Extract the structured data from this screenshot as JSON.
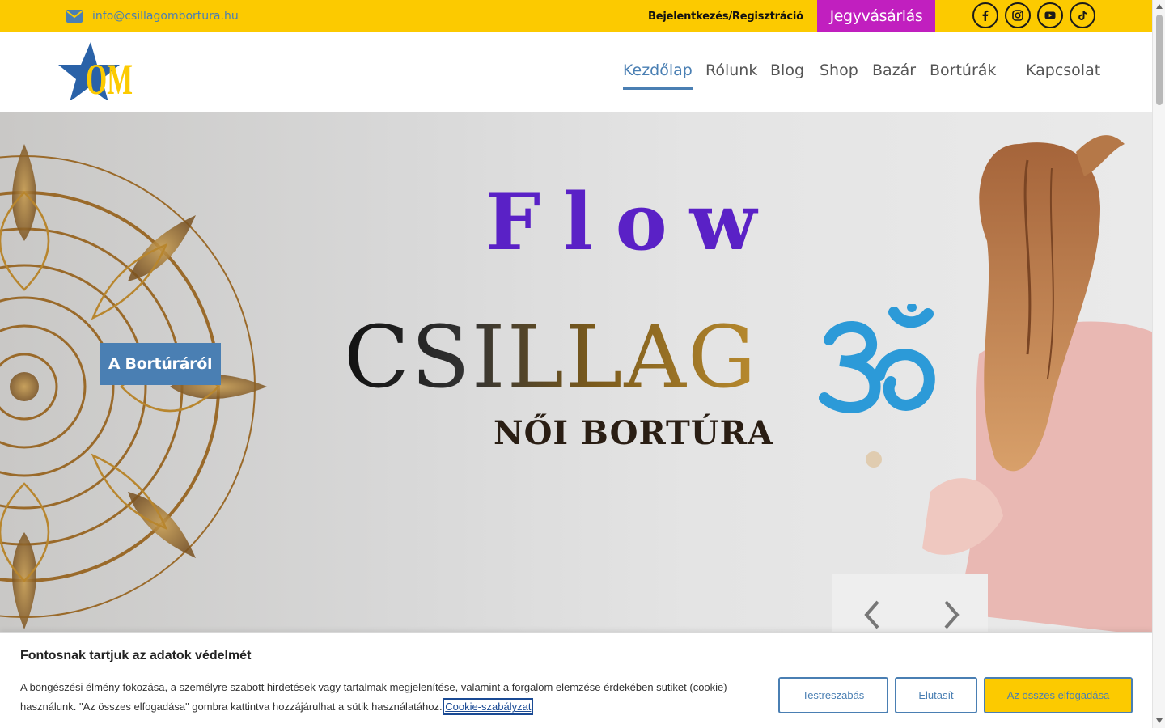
{
  "topbar": {
    "email": "info@csillagombortura.hu",
    "login_label": "Bejelentkezés/Regisztráció",
    "ticket_label": "Jegyvásárlás",
    "social": [
      "facebook-icon",
      "instagram-icon",
      "youtube-icon",
      "tiktok-icon"
    ]
  },
  "header": {
    "logo_text": "OM",
    "nav": [
      {
        "label": "Kezdőlap",
        "active": true
      },
      {
        "label": "Rólunk"
      },
      {
        "label": "Blog"
      },
      {
        "label": "Shop"
      },
      {
        "label": "Bazár"
      },
      {
        "label": "Bortúrák"
      },
      {
        "label": "Kapcsolat"
      }
    ]
  },
  "hero": {
    "title_flow": "Flow",
    "title_csillag": "CSILLAG",
    "subtitle": "NŐI BORTÚRA",
    "button_label": "A Bortúráról",
    "prev_icon": "chevron-left-icon",
    "next_icon": "chevron-right-icon"
  },
  "cookie": {
    "title": "Fontosnak tartjuk az adatok védelmét",
    "text": "A böngészési élmény fokozása, a személyre szabott hirdetések vagy tartalmak megjelenítése, valamint a forgalom elemzése érdekében sütiket (cookie) használunk. \"Az összes elfogadása\" gombra kattintva hozzájárulhat a sütik használatához.",
    "policy_link": "Cookie-szabályzat",
    "customize_label": "Testreszabás",
    "reject_label": "Elutasít",
    "accept_label": "Az összes elfogadása"
  },
  "colors": {
    "yellow": "#fcca00",
    "blue": "#4a7fb3",
    "magenta": "#c11fbf",
    "purple": "#5a21c6",
    "om_blue": "#2c9ad8"
  }
}
